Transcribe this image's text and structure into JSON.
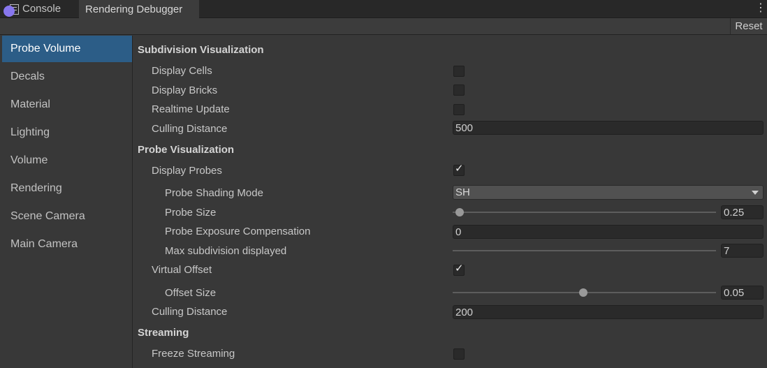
{
  "tabs": {
    "console_label": "Console",
    "debugger_label": "Rendering Debugger",
    "console_icon": "console-icon",
    "menu_icon": "kebab-menu-icon"
  },
  "toolbar": {
    "reset_label": "Reset"
  },
  "sidebar": {
    "items": [
      {
        "label": "Probe Volume",
        "active": true
      },
      {
        "label": "Decals"
      },
      {
        "label": "Material"
      },
      {
        "label": "Lighting"
      },
      {
        "label": "Volume"
      },
      {
        "label": "Rendering"
      },
      {
        "label": "Scene Camera"
      },
      {
        "label": "Main Camera"
      }
    ]
  },
  "panel": {
    "subdivision": {
      "header": "Subdivision Visualization",
      "display_cells": {
        "label": "Display Cells",
        "checked": false
      },
      "display_bricks": {
        "label": "Display Bricks",
        "checked": false
      },
      "realtime_update": {
        "label": "Realtime Update",
        "checked": false
      },
      "culling_distance": {
        "label": "Culling Distance",
        "value": "500"
      }
    },
    "probe": {
      "header": "Probe Visualization",
      "display_probes": {
        "label": "Display Probes",
        "checked": true,
        "checkmark": "✓"
      },
      "shading_mode": {
        "label": "Probe Shading Mode",
        "value": "SH"
      },
      "probe_size": {
        "label": "Probe Size",
        "value": "0.25",
        "slider_fraction": 0.0
      },
      "exposure": {
        "label": "Probe Exposure Compensation",
        "value": "0"
      },
      "max_subdivision": {
        "label": "Max subdivision displayed",
        "value": "7",
        "slider_fraction": 1.0
      },
      "virtual_offset": {
        "label": "Virtual Offset",
        "checked": true,
        "checkmark": "✓"
      },
      "offset_size": {
        "label": "Offset Size",
        "value": "0.05",
        "slider_fraction": 0.5
      },
      "culling_distance": {
        "label": "Culling Distance",
        "value": "200"
      }
    },
    "streaming": {
      "header": "Streaming",
      "freeze_streaming": {
        "label": "Freeze Streaming",
        "checked": false
      }
    }
  },
  "colors": {
    "active_item_bg": "#2c5d87",
    "panel_bg": "#383838",
    "tab_bar_bg": "#282828",
    "dot_icon": "#8877ee"
  }
}
